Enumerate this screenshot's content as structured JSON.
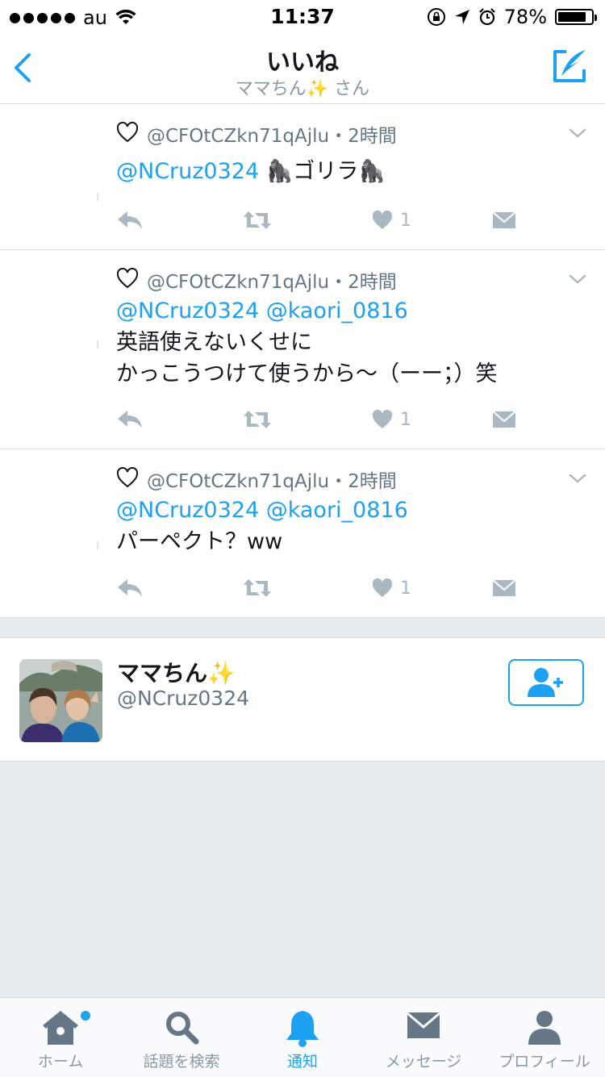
{
  "status_bar": {
    "carrier": "au",
    "time": "11:37",
    "battery_percent": "78%",
    "battery_level": 0.78
  },
  "nav": {
    "title": "いいね",
    "subtitle": "ママちん✨ さん"
  },
  "tweets": [
    {
      "meta": "@CFOtCZkn71qAjlu・2時間",
      "mentions": "@NCruz0324",
      "lines": [
        "🦍ゴリラ🦍"
      ],
      "like_count": "1"
    },
    {
      "meta": "@CFOtCZkn71qAjlu・2時間",
      "mentions": "@NCruz0324 @kaori_0816",
      "lines": [
        "英語使えないくせに",
        "かっこうつけて使うから〜（ーー；）笑"
      ],
      "like_count": "1"
    },
    {
      "meta": "@CFOtCZkn71qAjlu・2時間",
      "mentions": "@NCruz0324 @kaori_0816",
      "lines": [
        "パーペクト？ww"
      ],
      "like_count": "1"
    }
  ],
  "user_card": {
    "name": "ママちん✨",
    "handle": "@NCruz0324"
  },
  "tab_bar": {
    "tabs": [
      {
        "label": "ホーム",
        "icon": "home-icon",
        "has_badge": true
      },
      {
        "label": "話題を検索",
        "icon": "search-icon"
      },
      {
        "label": "通知",
        "icon": "bell-icon",
        "active": true
      },
      {
        "label": "メッセージ",
        "icon": "envelope-icon"
      },
      {
        "label": "プロフィール",
        "icon": "person-icon"
      }
    ]
  },
  "colors": {
    "accent": "#1da1f2",
    "muted": "#aab8c2",
    "background": "#e6ecf0"
  }
}
